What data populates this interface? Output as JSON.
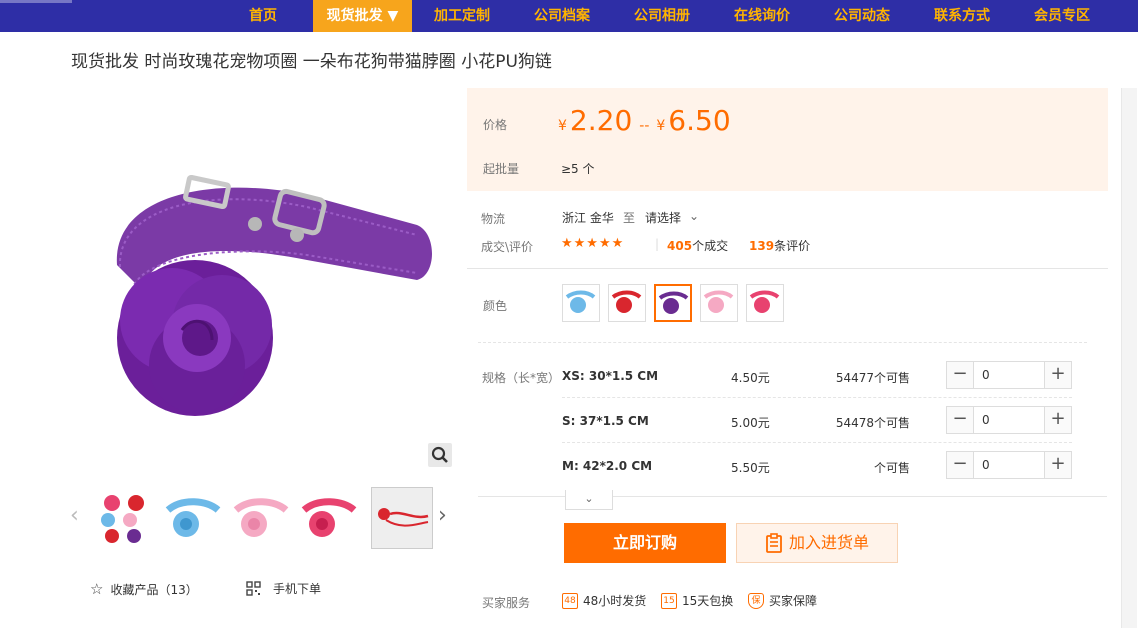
{
  "nav": {
    "items": [
      {
        "label": "首页"
      },
      {
        "label": "现货批发 ▼"
      },
      {
        "label": "加工定制"
      },
      {
        "label": "公司档案"
      },
      {
        "label": "公司相册"
      },
      {
        "label": "在线询价"
      },
      {
        "label": "公司动态"
      },
      {
        "label": "联系方式"
      },
      {
        "label": "会员专区"
      }
    ],
    "active_index": 1
  },
  "product": {
    "title": "现货批发 时尚玫瑰花宠物项圈 一朵布花狗带猫脖圈 小花PU狗链",
    "collect_label": "收藏产品（13）",
    "mobile_order_label": "手机下单"
  },
  "price": {
    "label": "价格",
    "currency": "¥",
    "min": "2.20",
    "sep": "--",
    "max": "6.50",
    "moq_label": "起批量",
    "moq_value": "≥5 个"
  },
  "logistics": {
    "label": "物流",
    "from": "浙江 金华",
    "to_word": "至",
    "dest_placeholder": "请选择"
  },
  "reviews": {
    "label": "成交\\评价",
    "stars": "★★★★★",
    "deals_count": "405",
    "deals_suffix": "个成交",
    "review_count": "139",
    "review_suffix": "条评价"
  },
  "color": {
    "label": "颜色",
    "swatches": [
      {
        "color": "#6db9e8"
      },
      {
        "color": "#d9262e"
      },
      {
        "color": "#6a2c91"
      },
      {
        "color": "#f5a9c3"
      },
      {
        "color": "#e8426f"
      }
    ],
    "selected_index": 2
  },
  "sku": {
    "label": "规格（长*宽）",
    "rows": [
      {
        "name": "XS: 30*1.5 CM",
        "price": "4.50元",
        "stock": "54477个可售",
        "qty": "0"
      },
      {
        "name": "S: 37*1.5 CM",
        "price": "5.00元",
        "stock": "54478个可售",
        "qty": "0"
      },
      {
        "name": "M: 42*2.0 CM",
        "price": "5.50元",
        "stock": "个可售",
        "qty": "0"
      }
    ]
  },
  "buttons": {
    "buy": "立即订购",
    "cart": "加入进货单"
  },
  "services": {
    "label": "买家服务",
    "items": [
      {
        "icon": "48",
        "label": "48小时发货"
      },
      {
        "icon": "15",
        "label": "15天包换"
      },
      {
        "icon": "保",
        "label": "买家保障"
      }
    ]
  },
  "colors": {
    "nav_bg": "#2e2ea6",
    "nav_text": "#ffb400",
    "accent": "#ff6c00",
    "price_bg": "#fff3ea"
  }
}
